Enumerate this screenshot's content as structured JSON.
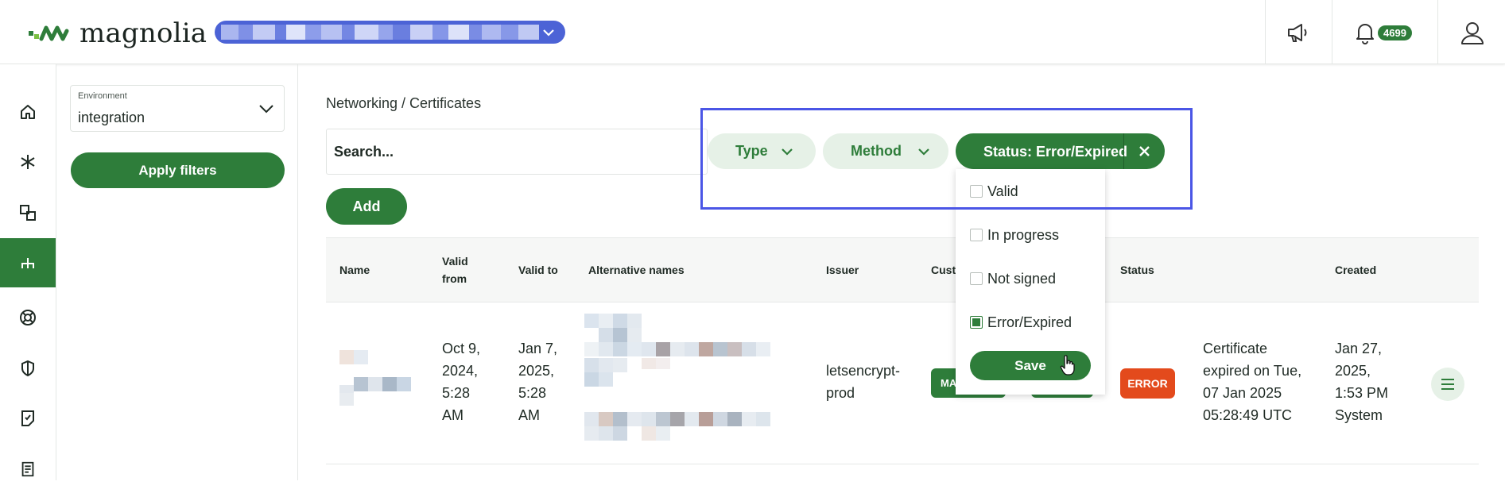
{
  "header": {
    "logo_text": "magnolia",
    "notifications_count": "4699",
    "icons": [
      "megaphone-icon",
      "bell-icon",
      "user-icon"
    ]
  },
  "leftnav": {
    "items": [
      "home-icon",
      "asterisk-icon",
      "shapes-icon",
      "network-icon",
      "support-icon",
      "shield-icon",
      "document-icon",
      "notes-icon"
    ],
    "active": "network-icon"
  },
  "filters": {
    "environment_label": "Environment",
    "environment_value": "integration",
    "apply_label": "Apply filters"
  },
  "main": {
    "breadcrumb": "Networking / Certificates",
    "search_placeholder": "Search...",
    "filter_type_label": "Type",
    "filter_method_label": "Method",
    "filter_status_label": "Status: Error/Expired",
    "add_label": "Add"
  },
  "status_dropdown": {
    "options": [
      {
        "label": "Valid",
        "checked": false
      },
      {
        "label": "In progress",
        "checked": false
      },
      {
        "label": "Not signed",
        "checked": false
      },
      {
        "label": "Error/Expired",
        "checked": true
      }
    ],
    "save_label": "Save"
  },
  "table": {
    "headers": {
      "name": "Name",
      "valid_from_1": "Valid",
      "valid_from_2": "from",
      "valid_to": "Valid to",
      "alt_names": "Alternative names",
      "issuer": "Issuer",
      "custom": "Custo",
      "status": "Status",
      "created": "Created"
    },
    "rows": [
      {
        "valid_from": [
          "Oct 9,",
          "2024,",
          "5:28",
          "AM"
        ],
        "valid_to": [
          "Jan 7,",
          "2025,",
          "5:28",
          "AM"
        ],
        "issuer": [
          "letsencrypt-",
          "prod"
        ],
        "custom_tag": "MA",
        "status_badge": "ERROR",
        "status_detail": [
          "Certificate",
          "expired on Tue,",
          "07 Jan 2025",
          "05:28:49 UTC"
        ],
        "created": [
          "Jan 27,",
          "2025,",
          "1:53 PM",
          "System"
        ]
      }
    ]
  },
  "colors": {
    "brand_green": "#2e7d3a",
    "light_green": "#e6f1e7",
    "org_blue": "#4c63d6",
    "error_red": "#e34a1c",
    "highlight_blue": "#4b56e6"
  }
}
